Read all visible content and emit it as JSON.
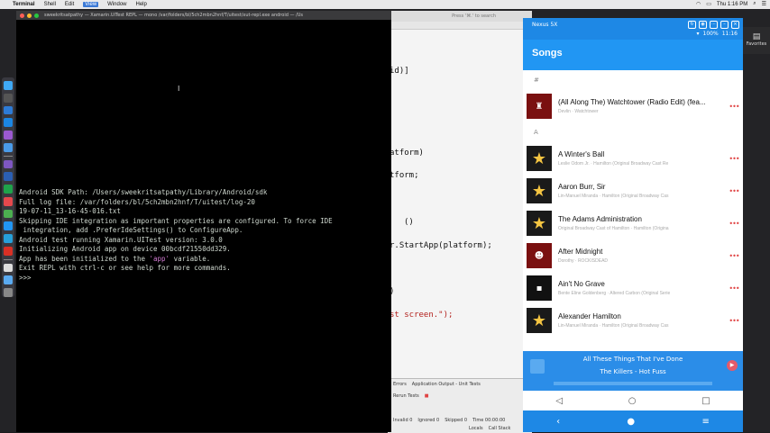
{
  "menubar": {
    "app": "Terminal",
    "items": [
      "Shell",
      "Edit",
      "View",
      "Window",
      "Help"
    ],
    "active": "View",
    "clock": "Thu 1:16 PM"
  },
  "terminal": {
    "title": "sweekritsatpathy — Xamarin.UITest REPL — mono /var/folders/bl/5ch2mbn2hnf/T/uitest/xut-repl.exe android — /Us",
    "lines": [
      "Android SDK Path: /Users/sweekritsatpathy/Library/Android/sdk",
      "Full log file: /var/folders/bl/5ch2mbn2hnf/T/uitest/log-20",
      "19-07-11_13-16-45-016.txt",
      "Skipping IDE integration as important properties are configured. To force IDE",
      " integration, add .PreferIdeSettings() to ConfigureApp.",
      "Android test running Xamarin.UITest version: 3.0.0",
      "Initializing Android app on device 00bcdf21550dd329.",
      "",
      "App has been initialized to the 'app' variable.",
      "Exit REPL with ctrl-c or see help for more commands.",
      "",
      ">>> "
    ]
  },
  "ide": {
    "search_placeholder": "Press '⌘.' to search",
    "code_lines": [
      "id)]",
      "atform)",
      "tform;",
      "()",
      "r.StartApp(platform);",
      ")",
      "st screen.\");"
    ],
    "pad_tabs": [
      "Errors",
      "Application Output - Unit Tests"
    ],
    "rerun": "Rerun Tests",
    "stats": [
      "Invalid 0",
      "Ignored 0",
      "Skipped 0",
      "Time 00:00:00"
    ],
    "footer": [
      "Locals",
      "Call Stack"
    ]
  },
  "emulator": {
    "device": "Nexus 5X",
    "status": {
      "battery": "100%",
      "time": "11:16"
    },
    "app_title": "Songs",
    "sections": [
      {
        "header": "#",
        "songs": [
          {
            "title": "(All Along The) Watchtower (Radio Edit) (fea...",
            "subtitle": "Devlin · Watchtower",
            "thumb": "red"
          }
        ]
      },
      {
        "header": "A",
        "songs": [
          {
            "title": "A Winter's Ball",
            "subtitle": "Leslie Odom Jr. · Hamilton (Original Broadway Cast Re",
            "thumb": "star"
          },
          {
            "title": "Aaron Burr, Sir",
            "subtitle": "Lin-Manuel Miranda · Hamilton (Original Broadway Cas",
            "thumb": "star"
          },
          {
            "title": "The Adams Administration",
            "subtitle": "Original Broadway Cast of Hamilton · Hamilton (Origina",
            "thumb": "star"
          },
          {
            "title": "After Midnight",
            "subtitle": "Dorothy · ROCKISDEAD",
            "thumb": "red"
          },
          {
            "title": "Ain't No Grave",
            "subtitle": "Bente Eline Goldenberg · Altered Carbon (Original Serie",
            "thumb": "dark"
          },
          {
            "title": "Alexander Hamilton",
            "subtitle": "Lin-Manuel Miranda · Hamilton (Original Broadway Cas",
            "thumb": "star"
          }
        ]
      }
    ],
    "now_playing": {
      "title": "All These Things That I've Done",
      "artist": "The Killers - Hot Fuss"
    }
  },
  "favorites": "Favorites",
  "colors": {
    "android_primary": "#2196f3",
    "android_dark": "#1e88e5",
    "accent": "#e04444"
  }
}
